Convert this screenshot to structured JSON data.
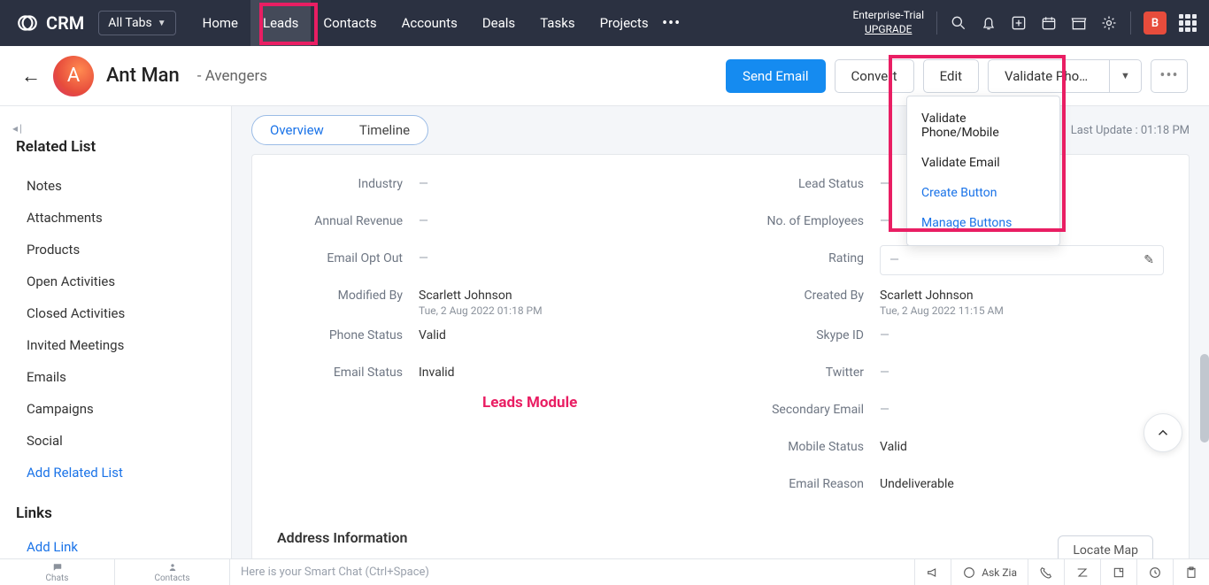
{
  "topbar": {
    "brand": "CRM",
    "all_tabs": "All Tabs",
    "nav": [
      "Home",
      "Leads",
      "Contacts",
      "Accounts",
      "Deals",
      "Tasks",
      "Projects"
    ],
    "trial_line1": "Enterprise-Trial",
    "trial_upgrade": "UPGRADE",
    "avatar_letter": "B"
  },
  "record": {
    "avatar_letter": "A",
    "name": "Ant Man",
    "subtitle": "- Avengers",
    "send_email": "Send Email",
    "convert": "Convert",
    "edit": "Edit",
    "validate_label": "Validate Phon…",
    "more": "•••"
  },
  "dropdown": {
    "items": [
      "Validate Phone/Mobile",
      "Validate Email"
    ],
    "links": [
      "Create Button",
      "Manage Buttons"
    ]
  },
  "sidebar": {
    "handle": "◂|",
    "title": "Related List",
    "items": [
      "Notes",
      "Attachments",
      "Products",
      "Open Activities",
      "Closed Activities",
      "Invited Meetings",
      "Emails",
      "Campaigns",
      "Social"
    ],
    "add_related": "Add Related List",
    "links_title": "Links",
    "add_link": "Add Link"
  },
  "tabs": {
    "overview": "Overview",
    "timeline": "Timeline",
    "last_update_label": "Last Update : ",
    "last_update_value": "01:18 PM"
  },
  "fields": {
    "left": [
      {
        "label": "Industry",
        "value": "—"
      },
      {
        "label": "Annual Revenue",
        "value": "—"
      },
      {
        "label": "Email Opt Out",
        "value": "—"
      },
      {
        "label": "Modified By",
        "value": "Scarlett Johnson",
        "sub": "Tue, 2 Aug 2022 01:18 PM"
      },
      {
        "label": "Phone Status",
        "value": "Valid"
      },
      {
        "label": "Email Status",
        "value": "Invalid"
      }
    ],
    "right": [
      {
        "label": "Lead Status",
        "value": "—"
      },
      {
        "label": "No. of Employees",
        "value": "—"
      },
      {
        "label": "Rating",
        "value": "—",
        "rating": true
      },
      {
        "label": "Created By",
        "value": "Scarlett Johnson",
        "sub": "Tue, 2 Aug 2022 11:15 AM"
      },
      {
        "label": "Skype ID",
        "value": "—"
      },
      {
        "label": "Twitter",
        "value": "—"
      },
      {
        "label": "Secondary Email",
        "value": "—"
      },
      {
        "label": "Mobile Status",
        "value": "Valid"
      },
      {
        "label": "Email Reason",
        "value": "Undeliverable"
      }
    ]
  },
  "module_annotation": "Leads Module",
  "address_section": "Address Information",
  "locate_map": "Locate Map",
  "footer": {
    "chats": "Chats",
    "contacts": "Contacts",
    "smartchat": "Here is your Smart Chat (Ctrl+Space)",
    "ask_zia": "Ask Zia"
  }
}
